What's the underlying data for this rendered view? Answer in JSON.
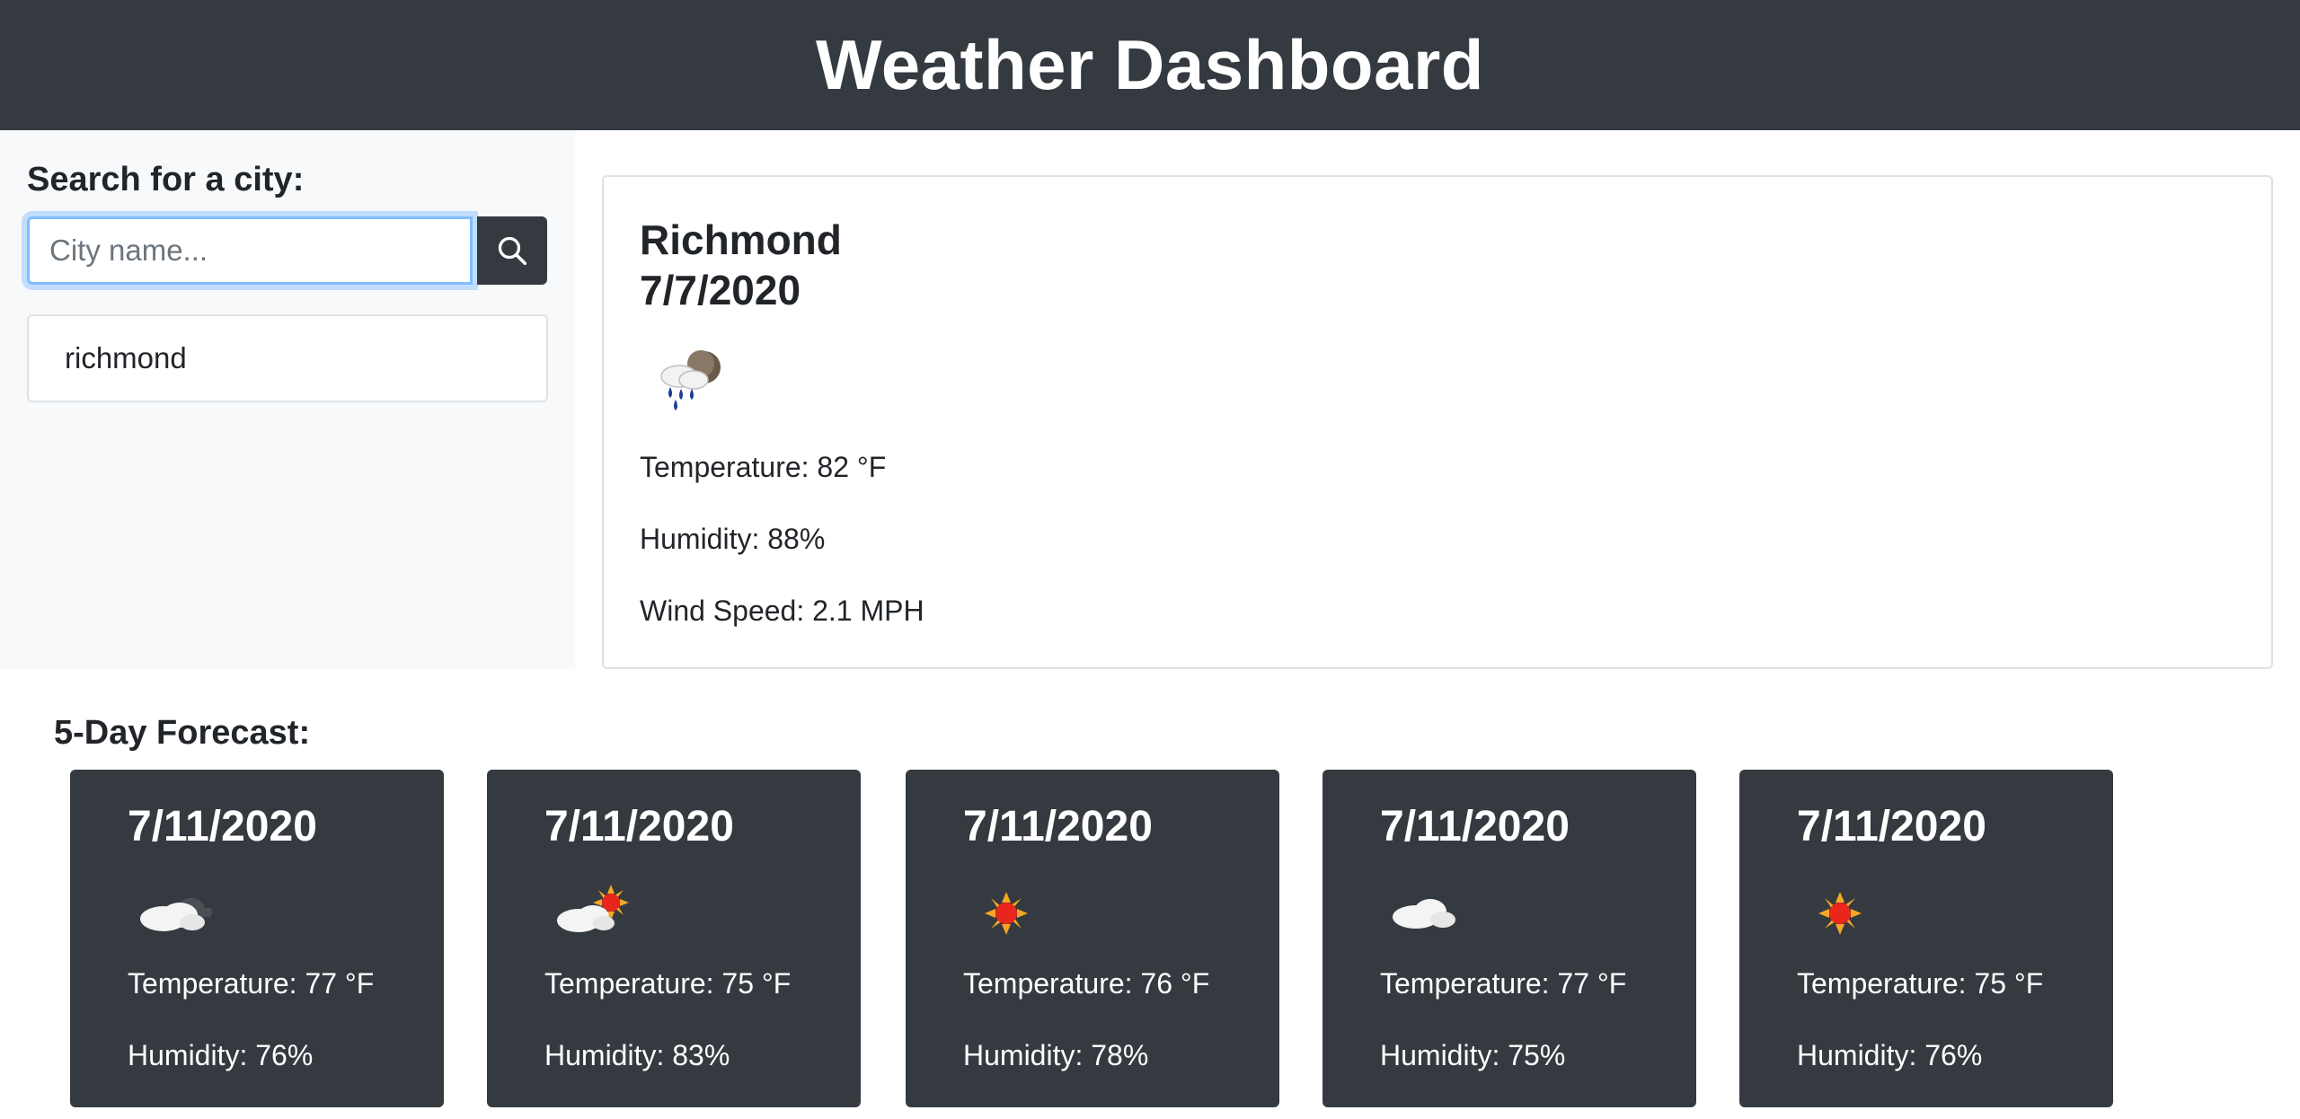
{
  "header": {
    "title": "Weather Dashboard"
  },
  "sidebar": {
    "search_label": "Search for a city:",
    "search_placeholder": "City name...",
    "search_value": "",
    "search_button_icon": "search-icon",
    "history": [
      {
        "label": "richmond"
      }
    ]
  },
  "current": {
    "city": "Richmond",
    "date": "7/7/2020",
    "icon": "rain-night-icon",
    "temperature": "Temperature: 82 °F",
    "humidity": "Humidity: 88%",
    "wind": "Wind Speed: 2.1 MPH"
  },
  "forecast": {
    "title": "5-Day Forecast:",
    "days": [
      {
        "date": "7/11/2020",
        "icon": "cloud-night-icon",
        "temperature": "Temperature: 77 °F",
        "humidity": "Humidity: 76%"
      },
      {
        "date": "7/11/2020",
        "icon": "partly-sunny-icon",
        "temperature": "Temperature: 75 °F",
        "humidity": "Humidity: 83%"
      },
      {
        "date": "7/11/2020",
        "icon": "sun-icon",
        "temperature": "Temperature: 76 °F",
        "humidity": "Humidity: 78%"
      },
      {
        "date": "7/11/2020",
        "icon": "cloud-icon",
        "temperature": "Temperature: 77 °F",
        "humidity": "Humidity: 75%"
      },
      {
        "date": "7/11/2020",
        "icon": "sun-icon",
        "temperature": "Temperature: 75 °F",
        "humidity": "Humidity: 76%"
      }
    ]
  },
  "colors": {
    "header_bg": "#343a40",
    "sidebar_bg": "#f8f9fa",
    "card_dark": "#343a40",
    "focus_border": "#80bdff"
  }
}
